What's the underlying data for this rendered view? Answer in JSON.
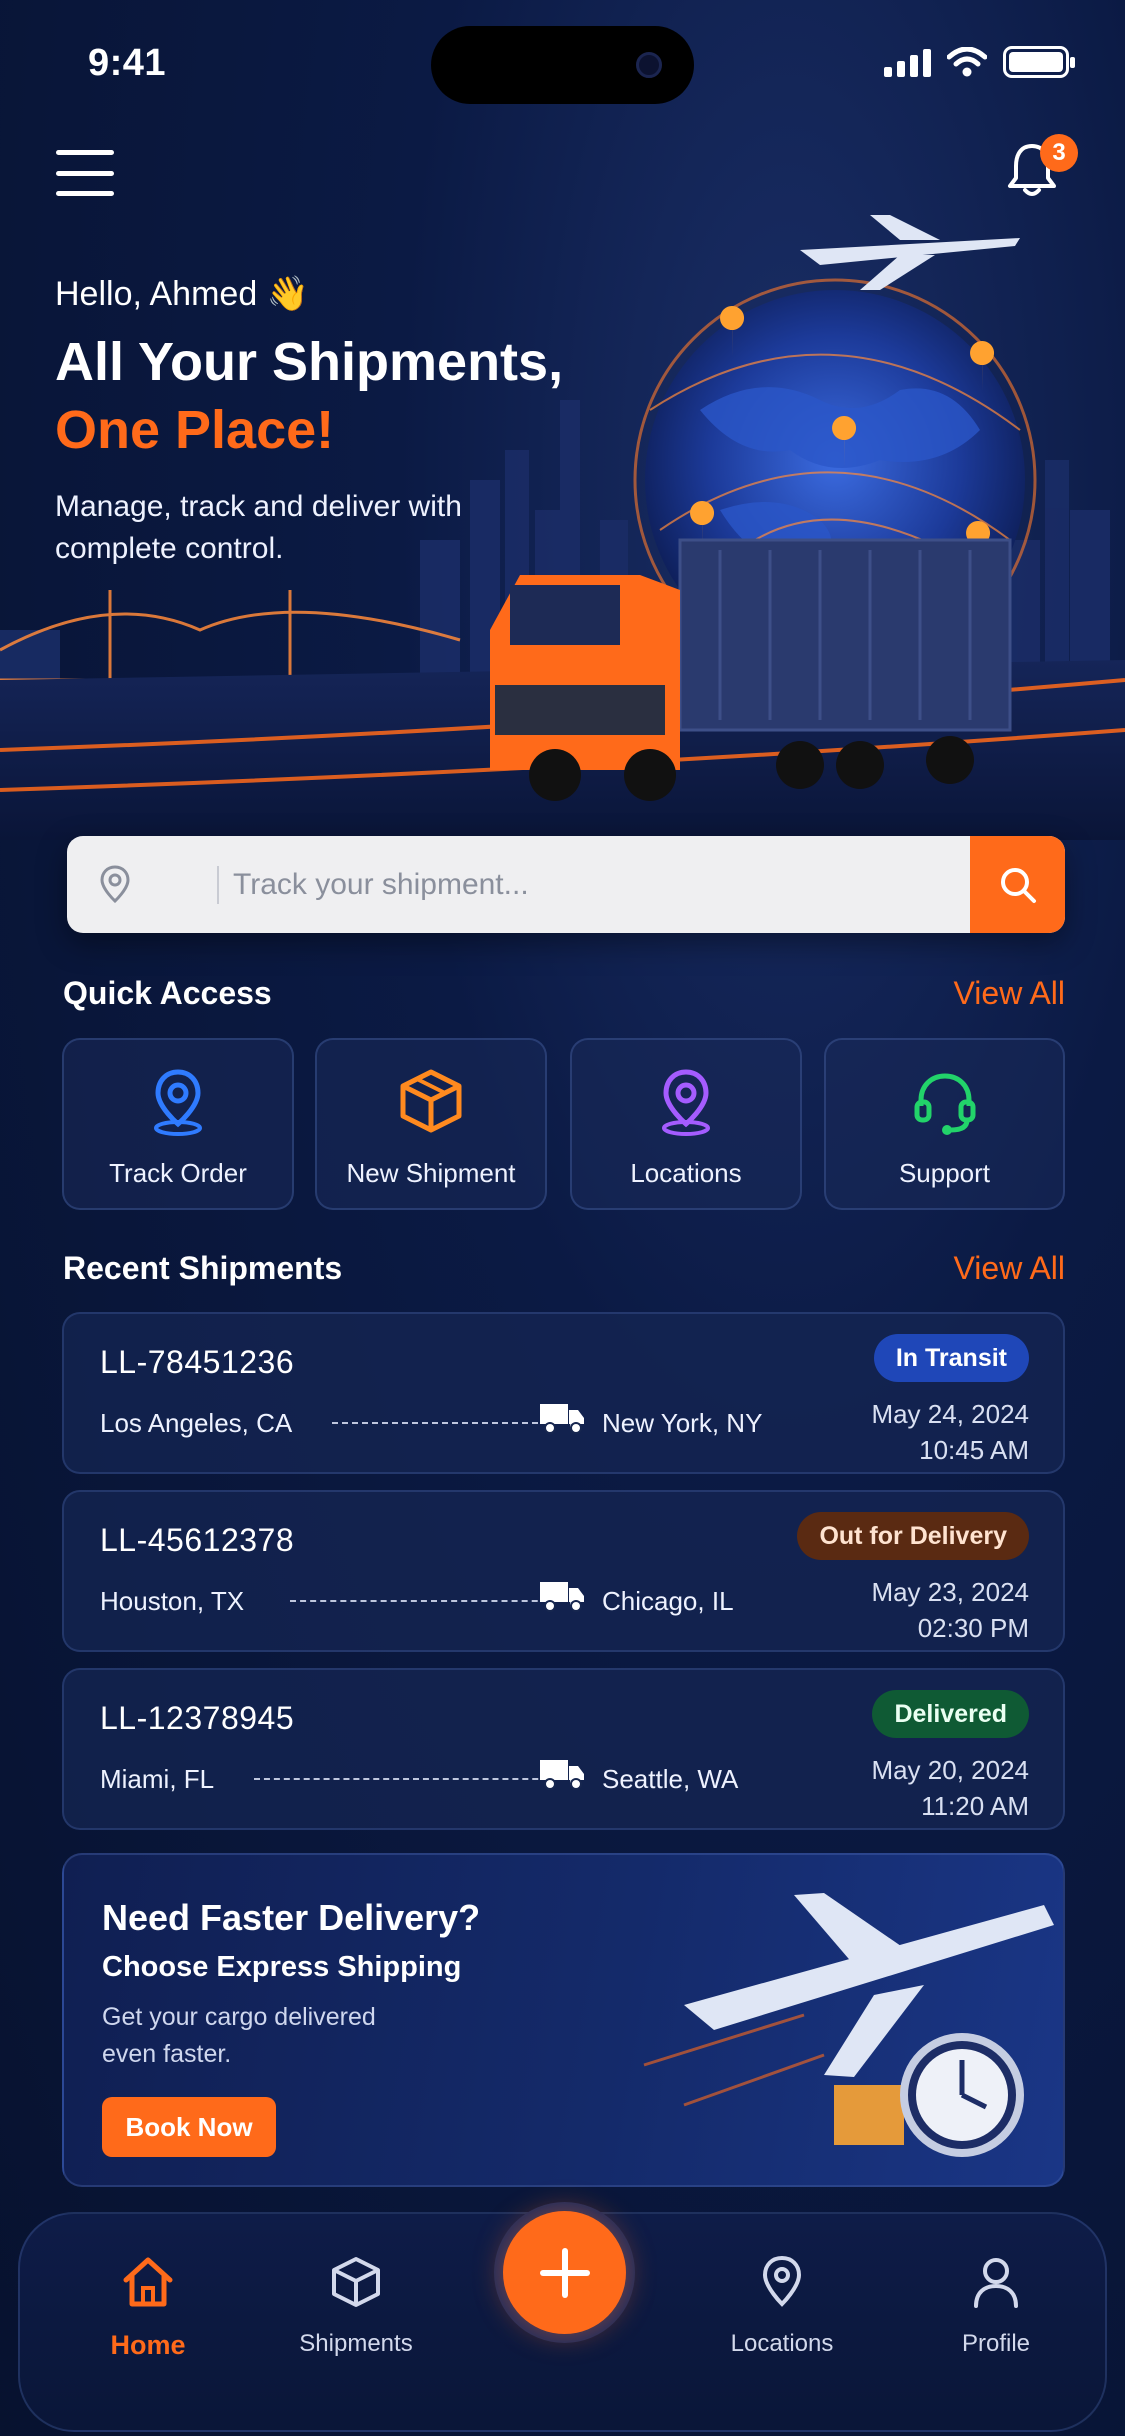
{
  "status_bar": {
    "time": "9:41"
  },
  "header": {
    "notification_count": "3"
  },
  "hero": {
    "greeting": "Hello, Ahmed 👋",
    "headline_line1": "All Your Shipments,",
    "headline_line2": "One Place!",
    "subtitle": "Manage, track and deliver with complete control."
  },
  "search": {
    "placeholder": "Track your shipment..."
  },
  "quick_access": {
    "title": "Quick Access",
    "view_all": "View All",
    "items": [
      {
        "label": "Track Order",
        "icon": "location-pin-icon",
        "color": "#2f7bff"
      },
      {
        "label": "New Shipment",
        "icon": "box-icon",
        "color": "#ff8a1f"
      },
      {
        "label": "Locations",
        "icon": "location-pin-icon",
        "color": "#a45cff"
      },
      {
        "label": "Support",
        "icon": "headset-icon",
        "color": "#22d36a"
      }
    ]
  },
  "recent_shipments": {
    "title": "Recent Shipments",
    "view_all": "View All",
    "items": [
      {
        "id": "LL-78451236",
        "from": "Los Angeles, CA",
        "to": "New York, NY",
        "status": "In Transit",
        "date": "May 24, 2024",
        "time": "10:45 AM"
      },
      {
        "id": "LL-45612378",
        "from": "Houston, TX",
        "to": "Chicago, IL",
        "status": "Out for Delivery",
        "date": "May 23, 2024",
        "time": "02:30 PM"
      },
      {
        "id": "LL-12378945",
        "from": "Miami, FL",
        "to": "Seattle, WA",
        "status": "Delivered",
        "date": "May 20, 2024",
        "time": "11:20 AM"
      }
    ]
  },
  "promo": {
    "title": "Need Faster Delivery?",
    "subtitle": "Choose Express Shipping",
    "description": "Get your cargo delivered even faster.",
    "button": "Book Now"
  },
  "bottom_nav": {
    "items": [
      {
        "label": "Home",
        "icon": "home-icon",
        "active": true
      },
      {
        "label": "Shipments",
        "icon": "box-icon",
        "active": false
      },
      {
        "label": "Locations",
        "icon": "location-pin-icon",
        "active": false
      },
      {
        "label": "Profile",
        "icon": "user-icon",
        "active": false
      }
    ],
    "fab_icon": "plus-icon"
  },
  "colors": {
    "accent": "#ff6a1a",
    "background": "#08163a",
    "transit": "#1f47b8",
    "out_for_delivery": "#5a2a12",
    "delivered": "#0f5a34"
  }
}
